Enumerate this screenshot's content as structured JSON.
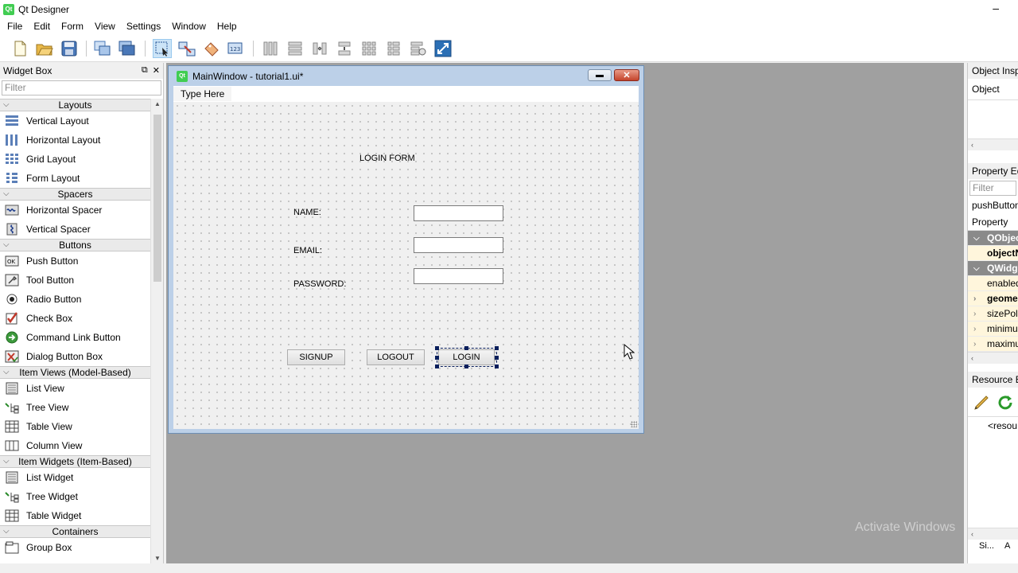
{
  "app": {
    "title": "Qt Designer",
    "logo": "Qt",
    "minimize": "–"
  },
  "menu": [
    "File",
    "Edit",
    "Form",
    "View",
    "Settings",
    "Window",
    "Help"
  ],
  "widget_box": {
    "title": "Widget Box",
    "filter_placeholder": "Filter",
    "float_glyph": "⧉",
    "close_glyph": "✕",
    "sections": [
      {
        "name": "Layouts",
        "items": [
          {
            "label": "Vertical Layout",
            "icon": "vertical-layout-icon"
          },
          {
            "label": "Horizontal Layout",
            "icon": "horizontal-layout-icon"
          },
          {
            "label": "Grid Layout",
            "icon": "grid-layout-icon"
          },
          {
            "label": "Form Layout",
            "icon": "form-layout-icon"
          }
        ]
      },
      {
        "name": "Spacers",
        "items": [
          {
            "label": "Horizontal Spacer",
            "icon": "horizontal-spacer-icon"
          },
          {
            "label": "Vertical Spacer",
            "icon": "vertical-spacer-icon"
          }
        ]
      },
      {
        "name": "Buttons",
        "items": [
          {
            "label": "Push Button",
            "icon": "push-button-icon"
          },
          {
            "label": "Tool Button",
            "icon": "tool-button-icon"
          },
          {
            "label": "Radio Button",
            "icon": "radio-button-icon"
          },
          {
            "label": "Check Box",
            "icon": "check-box-icon"
          },
          {
            "label": "Command Link Button",
            "icon": "command-link-icon"
          },
          {
            "label": "Dialog Button Box",
            "icon": "dialog-button-box-icon"
          }
        ]
      },
      {
        "name": "Item Views (Model-Based)",
        "items": [
          {
            "label": "List View",
            "icon": "list-view-icon"
          },
          {
            "label": "Tree View",
            "icon": "tree-view-icon"
          },
          {
            "label": "Table View",
            "icon": "table-view-icon"
          },
          {
            "label": "Column View",
            "icon": "column-view-icon"
          }
        ]
      },
      {
        "name": "Item Widgets (Item-Based)",
        "items": [
          {
            "label": "List Widget",
            "icon": "list-widget-icon"
          },
          {
            "label": "Tree Widget",
            "icon": "tree-widget-icon"
          },
          {
            "label": "Table Widget",
            "icon": "table-widget-icon"
          }
        ]
      },
      {
        "name": "Containers",
        "items": [
          {
            "label": "Group Box",
            "icon": "group-box-icon"
          }
        ]
      }
    ]
  },
  "form_window": {
    "title": "MainWindow - tutorial1.ui*",
    "logo": "Qt",
    "minimize_glyph": "▬",
    "close_glyph": "✕",
    "menubar_placeholder": "Type Here",
    "heading": "LOGIN FORM",
    "labels": {
      "name": "NAME:",
      "email": "EMAIL:",
      "password": "PASSWORD:"
    },
    "buttons": {
      "signup": "SIGNUP",
      "logout": "LOGOUT",
      "login": "LOGIN"
    },
    "selected_widget": "login-button"
  },
  "right_panel": {
    "object_inspector": {
      "title": "Object Inspe",
      "column": "Object"
    },
    "property_editor": {
      "title": "Property Edi",
      "filter_placeholder": "Filter",
      "object_name": "pushButton_",
      "column": "Property",
      "rows": [
        {
          "label": "QObjec",
          "type": "group"
        },
        {
          "label": "objectN",
          "type": "bold"
        },
        {
          "label": "QWidg",
          "type": "group"
        },
        {
          "label": "enabled",
          "type": "plain"
        },
        {
          "label": "geome",
          "type": "bold-expand"
        },
        {
          "label": "sizePoli",
          "type": "expand"
        },
        {
          "label": "minimu",
          "type": "expand"
        },
        {
          "label": "maximu",
          "type": "expand"
        }
      ]
    },
    "resource_browser": {
      "title": "Resource Br",
      "root": "<resou",
      "tabs": [
        "Si...",
        "A"
      ]
    }
  },
  "watermark": "Activate Windows",
  "colors": {
    "qt_green": "#41cd52",
    "selection": "#0a1f5c",
    "workspace": "#a0a0a0",
    "form_frame": "#bcd0e8"
  }
}
